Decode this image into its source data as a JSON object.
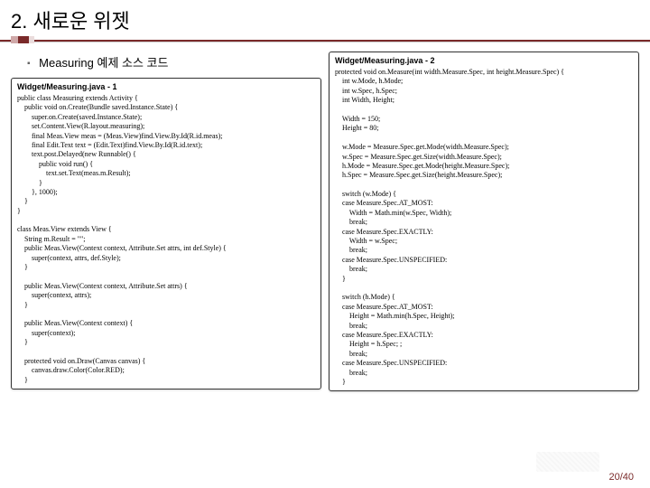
{
  "slide": {
    "title": "2. 새로운 위젯",
    "subhead": "Measuring 예제 소스 코드",
    "page": "20/40"
  },
  "left": {
    "caption": "Widget/Measuring.java - 1",
    "code": "public class Measuring extends Activity {\n    public void on.Create(Bundle saved.Instance.State) {\n        super.on.Create(saved.Instance.State);\n        set.Content.View(R.layout.measuring);\n        final Meas.View meas = (Meas.View)find.View.By.Id(R.id.meas);\n        final Edit.Text text = (Edit.Text)find.View.By.Id(R.id.text);\n        text.post.Delayed(new Runnable() {\n            public void run() {\n                text.set.Text(meas.m.Result);\n            }\n        }, 1000);\n    }\n}\n\nclass Meas.View extends View {\n    String m.Result = \"\";\n    public Meas.View(Context context, Attribute.Set attrs, int def.Style) {\n        super(context, attrs, def.Style);\n    }\n\n    public Meas.View(Context context, Attribute.Set attrs) {\n        super(context, attrs);\n    }\n\n    public Meas.View(Context context) {\n        super(context);\n    }\n\n    protected void on.Draw(Canvas canvas) {\n        canvas.draw.Color(Color.RED);\n    }"
  },
  "right": {
    "caption": "Widget/Measuring.java - 2",
    "code": "protected void on.Measure(int width.Measure.Spec, int height.Measure.Spec) {\n    int w.Mode, h.Mode;\n    int w.Spec, h.Spec;\n    int Width, Height;\n\n    Width = 150;\n    Height = 80;\n\n    w.Mode = Measure.Spec.get.Mode(width.Measure.Spec);\n    w.Spec = Measure.Spec.get.Size(width.Measure.Spec);\n    h.Mode = Measure.Spec.get.Mode(height.Measure.Spec);\n    h.Spec = Measure.Spec.get.Size(height.Measure.Spec);\n\n    switch (w.Mode) {\n    case Measure.Spec.AT_MOST:\n        Width = Math.min(w.Spec, Width);\n        break;\n    case Measure.Spec.EXACTLY:\n        Width = w.Spec;\n        break;\n    case Measure.Spec.UNSPECIFIED:\n        break;\n    }\n\n    switch (h.Mode) {\n    case Measure.Spec.AT_MOST:\n        Height = Math.min(h.Spec, Height);\n        break;\n    case Measure.Spec.EXACTLY:\n        Height = h.Spec; ;\n        break;\n    case Measure.Spec.UNSPECIFIED:\n        break;\n    }"
  }
}
